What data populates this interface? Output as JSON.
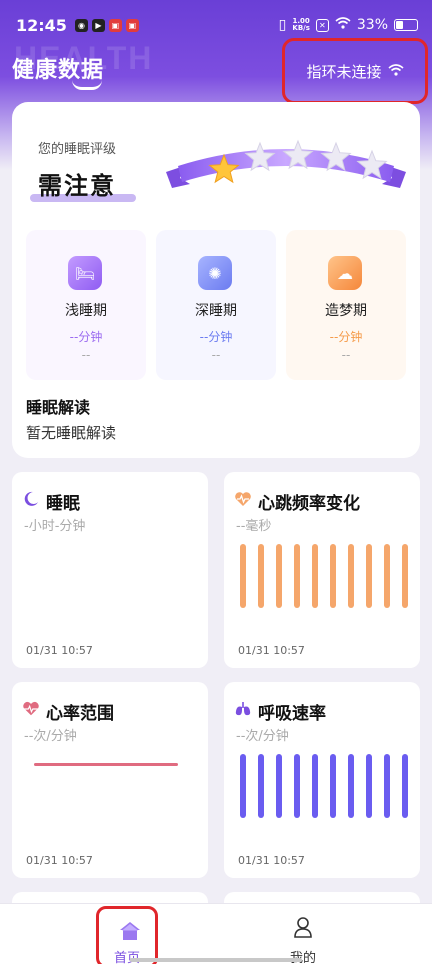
{
  "status_bar": {
    "time": "12:45",
    "net_speed_top": "1.00",
    "net_speed_bottom": "KB/s",
    "battery": "33%",
    "battery_level": 0.33
  },
  "header": {
    "watermark": "HEALTH",
    "title": "健康数据",
    "ring_status": "指环未连接"
  },
  "sleep_card": {
    "grade_label": "您的睡眠评级",
    "grade_value": "需注意",
    "stars_filled": 1,
    "stars_total": 5,
    "phases": [
      {
        "name": "浅睡期",
        "duration": "--分钟",
        "sub": "--",
        "color": "#9b6bf0"
      },
      {
        "name": "深睡期",
        "duration": "--分钟",
        "sub": "--",
        "color": "#6b7bf0"
      },
      {
        "name": "造梦期",
        "duration": "--分钟",
        "sub": "--",
        "color": "#f59b4a"
      }
    ],
    "interpretation_title": "睡眠解读",
    "interpretation_text": "暂无睡眠解读"
  },
  "tiles": {
    "sleep": {
      "title": "睡眠",
      "sub": "-小时-分钟",
      "time": "01/31 10:57"
    },
    "hrv": {
      "title": "心跳频率变化",
      "sub": "--毫秒",
      "time": "01/31 10:57",
      "color": "#f5a66b"
    },
    "heart_rate": {
      "title": "心率范围",
      "sub": "--次/分钟",
      "time": "01/31 10:57",
      "color": "#e06b80"
    },
    "respiration": {
      "title": "呼吸速率",
      "sub": "--次/分钟",
      "time": "01/31 10:57",
      "color": "#6a5cf0"
    }
  },
  "nav": {
    "home": "首页",
    "mine": "我的",
    "active_color": "#7b4fe0"
  },
  "colors": {
    "brand": "#7b4fe0",
    "highlight_border": "#e0262b"
  }
}
